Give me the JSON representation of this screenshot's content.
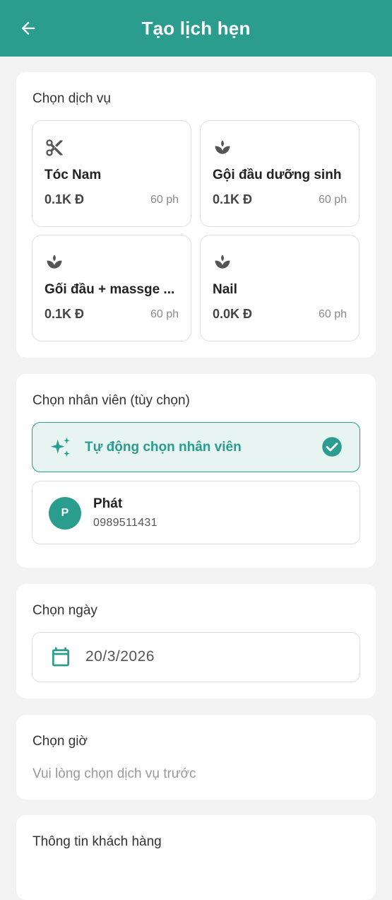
{
  "header": {
    "title": "Tạo lịch hẹn",
    "back_icon": "arrow-left-icon"
  },
  "services": {
    "title": "Chọn dịch vụ",
    "items": [
      {
        "icon": "scissors-icon",
        "name": "Tóc Nam",
        "price": "0.1K Đ",
        "duration": "60 ph"
      },
      {
        "icon": "spa-icon",
        "name": "Gội đầu dưỡng sinh",
        "price": "0.1K Đ",
        "duration": "60 ph"
      },
      {
        "icon": "spa-icon",
        "name": "Gối đầu + massge ...",
        "price": "0.1K Đ",
        "duration": "60 ph"
      },
      {
        "icon": "spa-icon",
        "name": "Nail",
        "price": "0.0K Đ",
        "duration": "60 ph"
      }
    ]
  },
  "staff": {
    "title": "Chọn nhân viên (tùy chọn)",
    "auto_label": "Tự động chọn nhân viên",
    "members": [
      {
        "initial": "P",
        "name": "Phát",
        "phone": "0989511431"
      }
    ]
  },
  "date": {
    "title": "Chọn ngày",
    "value": "20/3/2026",
    "icon": "calendar-icon"
  },
  "time": {
    "title": "Chọn giờ",
    "hint": "Vui lòng chọn dịch vụ trước"
  },
  "customer": {
    "title": "Thông tin khách hàng"
  },
  "colors": {
    "primary": "#2a9d8f",
    "selected_bg": "#e7f4f2",
    "background": "#f3f3f3"
  }
}
